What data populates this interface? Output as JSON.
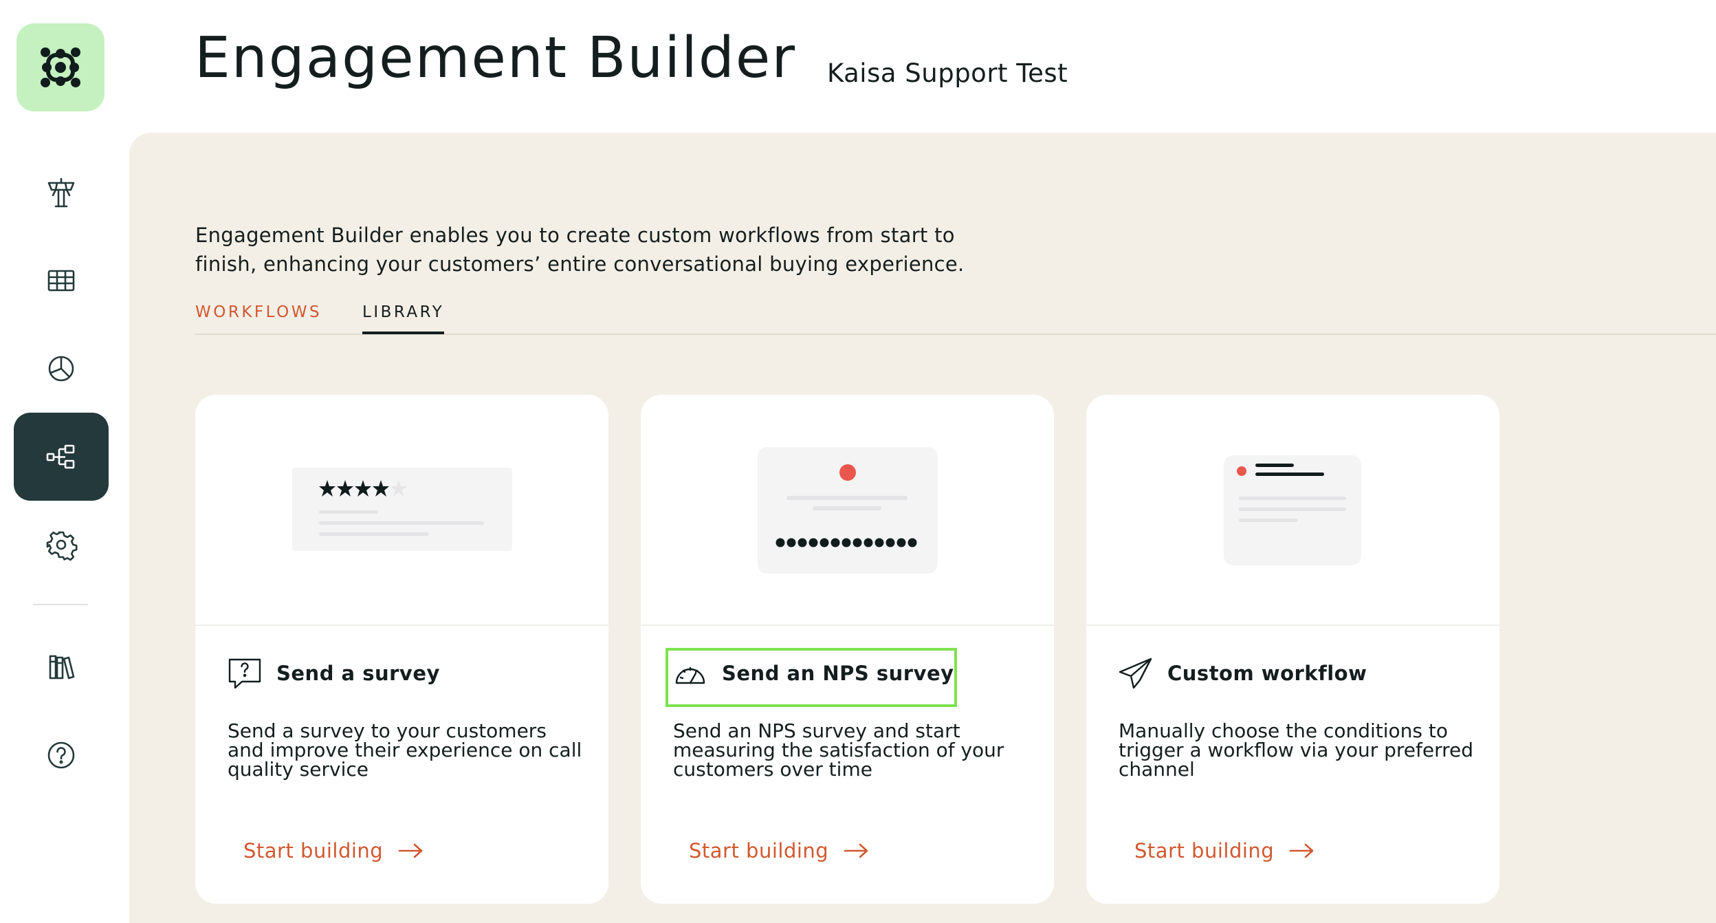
{
  "header": {
    "title": "Engagement Builder",
    "subtitle": "Kaisa Support Test"
  },
  "sidebar": {
    "items": [
      {
        "icon": "control-tower-icon",
        "active": false
      },
      {
        "icon": "table-grid-icon",
        "active": false
      },
      {
        "icon": "pie-chart-icon",
        "active": false
      },
      {
        "icon": "workflow-icon",
        "active": true
      },
      {
        "icon": "gear-icon",
        "active": false
      },
      {
        "icon": "books-icon",
        "active": false
      },
      {
        "icon": "help-icon",
        "active": false
      }
    ]
  },
  "main": {
    "intro": "Engagement Builder enables you to create custom workflows from start to finish, enhancing your customers’ entire conversational buying experience.",
    "tabs": [
      {
        "label": "WORKFLOWS",
        "active": false
      },
      {
        "label": "LIBRARY",
        "active": true
      }
    ],
    "cards": [
      {
        "title": "Send a survey",
        "description": "Send a survey to your customers and improve their experience on call quality service",
        "cta": "Start building",
        "icon": "survey-question-icon"
      },
      {
        "title": "Send an NPS survey",
        "description": "Send an NPS survey and start measuring the satisfaction of your customers over time",
        "cta": "Start building",
        "icon": "gauge-icon"
      },
      {
        "title": "Custom workflow",
        "description": "Manually choose the conditions to trigger a workflow via your preferred channel",
        "cta": "Start building",
        "icon": "paper-plane-icon"
      }
    ]
  },
  "colors": {
    "accent": "#d2582f",
    "panel_bg": "#f3efe6",
    "active_nav": "#24393b",
    "logo_bg": "#c5f1c0",
    "highlight": "#7de24f"
  }
}
